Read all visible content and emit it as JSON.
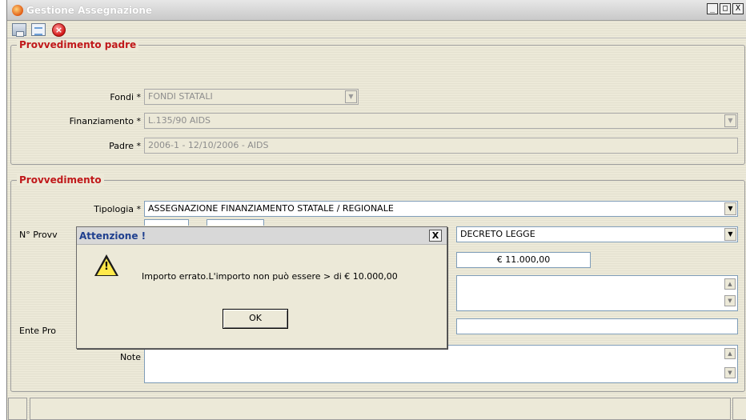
{
  "window": {
    "title": "Gestione Assegnazione",
    "controls": {
      "minimize": "_",
      "maximize": "□",
      "close": "X"
    }
  },
  "toolbar": {
    "icons": [
      "save-icon",
      "list-icon",
      "close-circle-icon"
    ]
  },
  "parent_group": {
    "legend": "Provvedimento padre",
    "fondi_label": "Fondi *",
    "fondi_value": "FONDI STATALI",
    "finanziamento_label": "Finanziamento *",
    "finanziamento_value": "L.135/90 AIDS",
    "padre_label": "Padre *",
    "padre_value": "2006-1 - 12/10/2006 - AIDS"
  },
  "provv_group": {
    "legend": "Provvedimento",
    "tipologia_label": "Tipologia *",
    "tipologia_value": "ASSEGNAZIONE FINANZIAMENTO STATALE / REGIONALE",
    "nprovv_label": "N° Provv",
    "tipo_atto_value": "DECRETO LEGGE",
    "importo_value": "€ 11.000,00",
    "ente_label": "Ente Pro",
    "note_label": "Note"
  },
  "dialog": {
    "title": "Attenzione !",
    "close": "X",
    "message": "Importo errato.L'importo non può essere > di € 10.000,00",
    "ok_label": "OK",
    "icon": "warning-icon"
  },
  "colors": {
    "legend": "#c0181a",
    "window_bg": "#ece9d8",
    "dialog_title_text": "#1f3f8f"
  }
}
